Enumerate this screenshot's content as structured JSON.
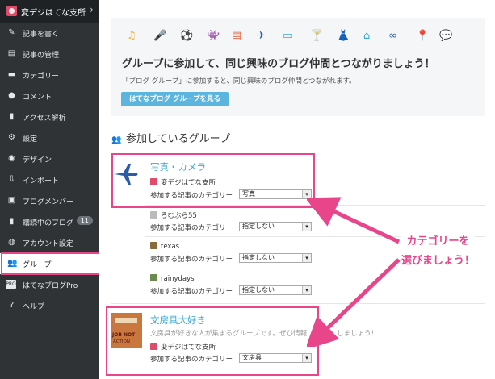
{
  "sidebar": {
    "blog_name": "変デジはてな支所",
    "items": [
      {
        "label": "記事を書く",
        "icon": "pencil-icon"
      },
      {
        "label": "記事の管理",
        "icon": "document-icon"
      },
      {
        "label": "カテゴリー",
        "icon": "folder-icon"
      },
      {
        "label": "コメント",
        "icon": "comment-icon"
      },
      {
        "label": "アクセス解析",
        "icon": "chart-icon"
      },
      {
        "label": "設定",
        "icon": "wrench-icon"
      },
      {
        "label": "デザイン",
        "icon": "palette-icon"
      },
      {
        "label": "インポート",
        "icon": "import-icon"
      },
      {
        "label": "ブログメンバー",
        "icon": "members-icon"
      },
      {
        "label": "購読中のブログ",
        "icon": "bookmark-icon",
        "badge": "11"
      },
      {
        "label": "アカウント設定",
        "icon": "account-icon"
      },
      {
        "label": "グループ",
        "icon": "group-icon"
      },
      {
        "label": "はてなブログPro",
        "icon": "pro-icon"
      },
      {
        "label": "ヘルプ",
        "icon": "help-icon"
      }
    ]
  },
  "promo": {
    "title": "グループに参加して、同じ興味のブログ仲間とつながりましょう！",
    "description": "「ブログ グループ」に参加すると、同じ興味のブログ仲間とつながれます。",
    "button": "はてなブログ グループを見る",
    "icons": [
      "music-note-icon",
      "microphone-icon",
      "soccer-ball-icon",
      "space-invader-icon",
      "notebook-icon",
      "airplane-icon",
      "monitor-icon",
      "cocktail-icon",
      "dress-icon",
      "house-icon",
      "glasses-icon",
      "map-pin-icon",
      "chat-bubble-icon"
    ]
  },
  "groups_heading": "参加しているグループ",
  "groups": [
    {
      "title": "写真・カメラ",
      "members": [
        {
          "name": "変デジはてな支所",
          "category_label": "参加する記事のカテゴリー",
          "category": "写真"
        },
        {
          "name": "ろむぶら55",
          "category_label": "参加する記事のカテゴリー",
          "category": "指定しない"
        },
        {
          "name": "texas",
          "category_label": "参加する記事のカテゴリー",
          "category": "指定しない"
        },
        {
          "name": "rainydays",
          "category_label": "参加する記事のカテゴリー",
          "category": "指定しない"
        }
      ]
    },
    {
      "title": "文房具大好き",
      "description": "文房具が好きな人が集まるグループです。ぜひ情報",
      "description_tail": "しましょう！",
      "thumb_text": [
        "LIFE",
        "JOB NOT",
        "ACTION"
      ],
      "members": [
        {
          "name": "変デジはてな支所",
          "category_label": "参加する記事のカテゴリー",
          "category": "文房具"
        }
      ]
    }
  ],
  "callout": {
    "line1": "カテゴリーを",
    "line2": "選びましょう！"
  },
  "colors": {
    "accent_pink": "#e8458b",
    "link_blue": "#3aa8d9",
    "button_blue": "#5bb5de",
    "sidebar_bg": "#2f3336"
  }
}
